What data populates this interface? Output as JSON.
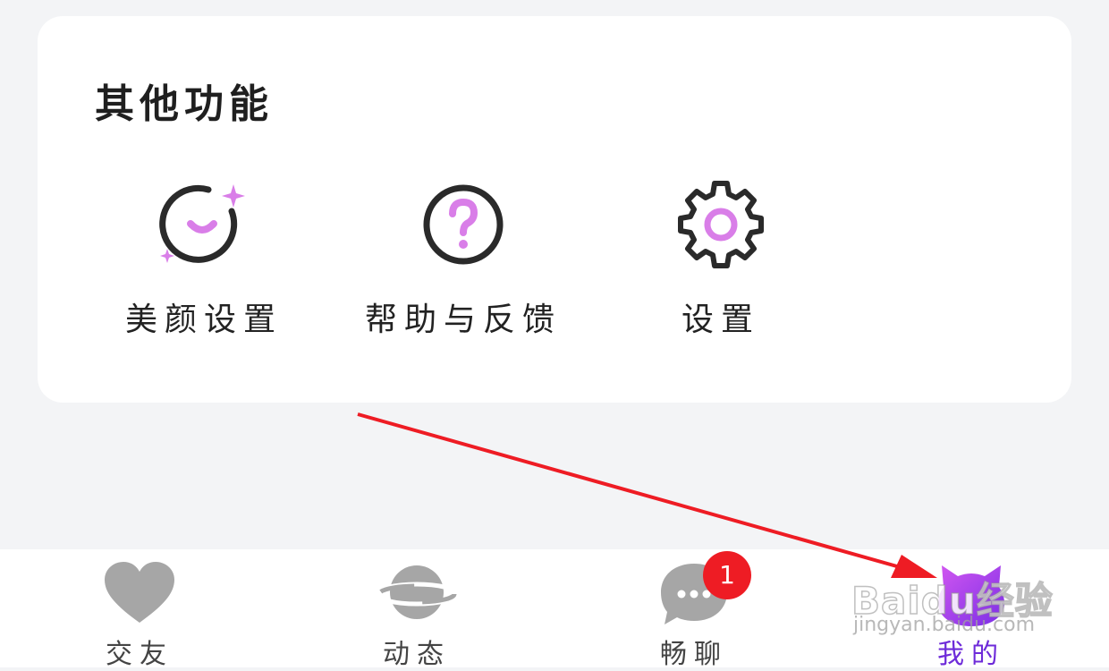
{
  "section": {
    "title": "其他功能",
    "features": [
      {
        "label": "美颜设置",
        "icon": "beauty-smile-sparkle-icon"
      },
      {
        "label": "帮助与反馈",
        "icon": "help-question-icon"
      },
      {
        "label": "设置",
        "icon": "gear-icon"
      }
    ]
  },
  "tabbar": {
    "tabs": [
      {
        "label": "交友",
        "icon": "heart-icon"
      },
      {
        "label": "动态",
        "icon": "planet-icon"
      },
      {
        "label": "畅聊",
        "icon": "chat-bubble-icon",
        "badge": "1"
      },
      {
        "label": "我的",
        "icon": "cat-profile-icon",
        "active": true
      }
    ]
  },
  "watermark": {
    "brand": "Baidu经验",
    "url": "jingyan.baidu.com"
  },
  "colors": {
    "background": "#f3f4f6",
    "card": "#ffffff",
    "accent_pink": "#d97ee8",
    "accent_purple": "#6e2bd9",
    "inactive_icon": "#a6a6a6",
    "badge": "#ee1c24",
    "annotation_arrow": "#ee1c24"
  }
}
